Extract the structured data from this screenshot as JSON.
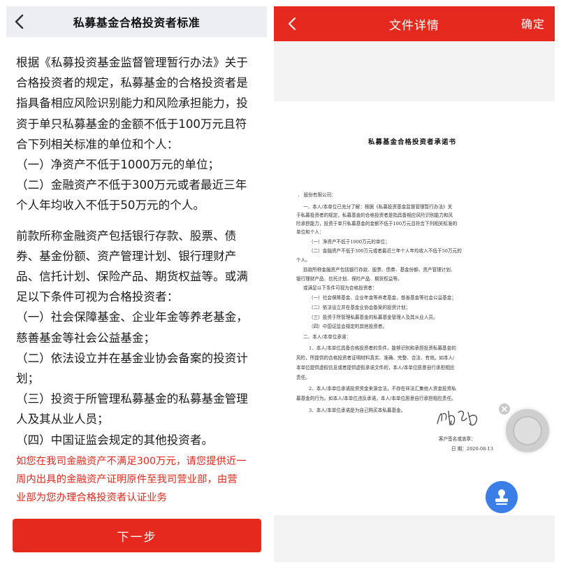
{
  "left": {
    "title": "私募基金合格投资者标准",
    "lines": [
      "根据《私募投资基金监督管理暂行办法》关于",
      "合格投资者的规定，私募基金的合格投资者是",
      "指具备相应风险识别能力和风险承担能力，投",
      "资于单只私募基金的金额不低于100万元且符",
      "合下列相关标准的单位和个人：",
      "（一）净资产不低于1000万元的单位；",
      "（二）金融资产不低于300万元或者最近三年",
      "个人年均收入不低于50万元的个人。"
    ],
    "lines2": [
      "前款所称金融资产包括银行存款、股票、债",
      "券、基金份额、资产管理计划、银行理财产",
      "品、信托计划、保险产品、期货权益等。或满",
      "足以下条件可视为合格投资者：",
      "（一）社会保障基金、企业年金等养老基金，",
      "慈善基金等社会公益基金；",
      "（二）依法设立并在基金业协会备案的投资计",
      "划；",
      "（三）投资于所管理私募基金的私募基金管理",
      "人及其从业人员；",
      "（四）中国证监会规定的其他投资者。"
    ],
    "warning_lines": [
      "如您在我司金融资产不满足300万元，请您提供近一",
      "周内出具的金融资产证明原件至我司营业部，由营",
      "业部为您办理合格投资者认证业务"
    ],
    "next_button": "下一步"
  },
  "right": {
    "title": "文件详情",
    "confirm": "确定",
    "doc_title": "私募基金合格投资者承诺书",
    "doc_lines": [
      "、    股份有限公司：",
      "一、本人/本单位已充分了解：根据《私募投资基金监督管理暂行办法》关",
      "于私募投资者的规定，私募基金的合格投资者是指具备相应风险识别能力和风",
      "险承担能力，投资于单只私募基金的金额不低于100万元且符合下列相关标准的",
      "单位和个人：",
      "（一）净资产不低于1000万元的单位；",
      "（二）金融资产不低于300万元或者最近三年个人年均收入不低于50万元的",
      "个人。",
      "前款所称金融资产包括银行存款、股票、债券、基金份额、资产管理计划、",
      "银行理财产品、信托计划、保险产品、期货权益等。",
      "或满足以下条件可视为合格投资者：",
      "（一）社会保障基金、企业年金等养老基金，慈善基金等社会公益基金；",
      "（二）依法设立并在基金业协会备案的投资计划；",
      "（三）投资于所管理私募基金的私募基金管理人及其从业人员。",
      "（四）中国证监会规定的其他投资者。",
      "二、本人/本单位承诺：",
      "1、本人/本单位具备合格投资者的条件，能够识别和承担投资私募基金的",
      "风险，所提供的合格投资者证明材料真实、准确、完整、合法、有效。如本人/",
      "本单位提供虚假信息或者提供虚假承诺文件的，本人/本单位愿意自行承担相应",
      "责任。",
      "2、本人/本单位承诺投资资金来源合法，不存在非法汇集他人资金投资私",
      "募基金的行为。如本人/本单位违反承诺，本人/本单位愿意自行承担相应责任。",
      "3、本人/本单位承诺是为自己购买本私募基金。"
    ],
    "sign_label": "客户签名或盖章：",
    "date_label": "日    期：2020-08-13"
  }
}
